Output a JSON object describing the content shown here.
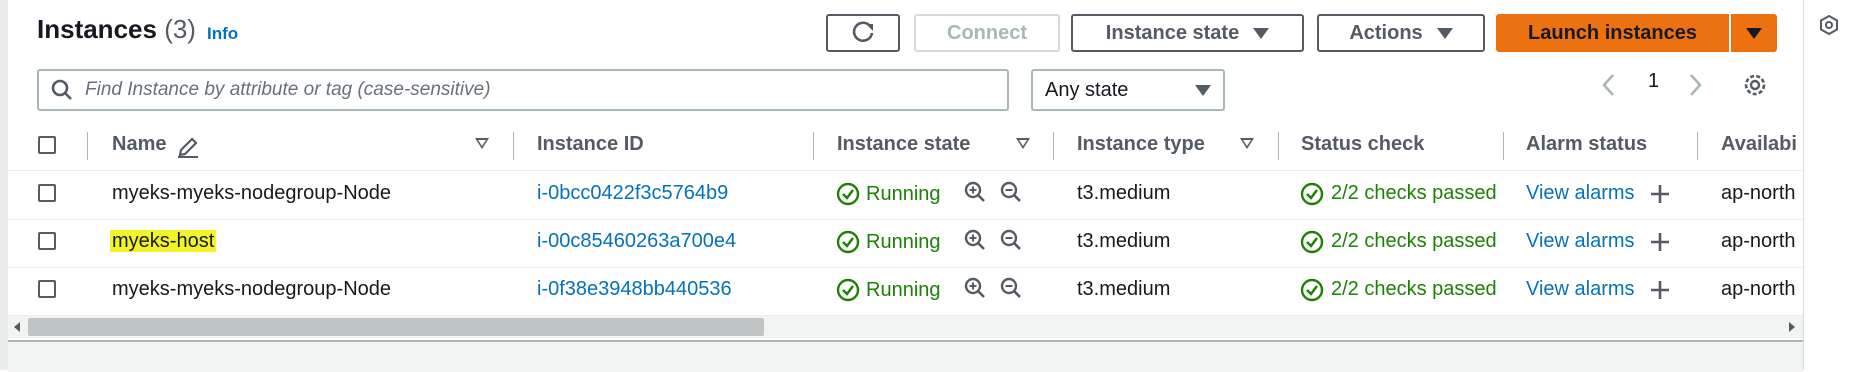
{
  "header": {
    "title": "Instances",
    "count": "(3)",
    "info": "Info"
  },
  "toolbar": {
    "refresh": "refresh-icon",
    "connect": "Connect",
    "instance_state": "Instance state",
    "actions": "Actions",
    "launch": "Launch instances"
  },
  "filter": {
    "search_placeholder": "Find Instance by attribute or tag (case-sensitive)",
    "state_value": "Any state"
  },
  "pagination": {
    "current_page": "1"
  },
  "table": {
    "columns": [
      "Name",
      "Instance ID",
      "Instance state",
      "Instance type",
      "Status check",
      "Alarm status",
      "Availabi"
    ],
    "rows": [
      {
        "name": "myeks-myeks-nodegroup-Node",
        "instance_id": "i-0bcc0422f3c5764b9",
        "state": "Running",
        "type": "t3.medium",
        "status": "2/2 checks passed",
        "alarm": "View alarms",
        "az": "ap-north"
      },
      {
        "name": "myeks-host",
        "instance_id": "i-00c85460263a700e4",
        "state": "Running",
        "type": "t3.medium",
        "status": "2/2 checks passed",
        "alarm": "View alarms",
        "az": "ap-north"
      },
      {
        "name": "myeks-myeks-nodegroup-Node",
        "instance_id": "i-0f38e3948bb440536",
        "state": "Running",
        "type": "t3.medium",
        "status": "2/2 checks passed",
        "alarm": "View alarms",
        "az": "ap-north"
      }
    ]
  },
  "colors": {
    "link": "#0073bb",
    "success": "#1d8102",
    "primary": "#ec7211",
    "highlight": "#f3f32a"
  }
}
